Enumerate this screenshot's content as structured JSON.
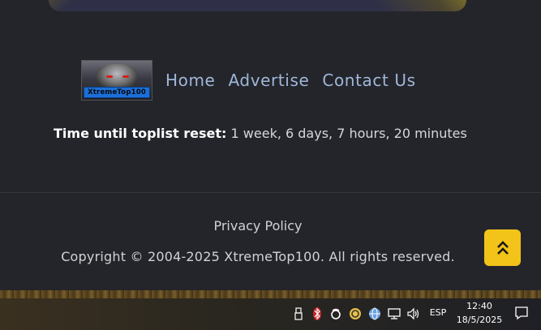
{
  "nav": {
    "logo_text": "XtremeTop100",
    "links": [
      "Home",
      "Advertise",
      "Contact Us"
    ]
  },
  "reset": {
    "label": "Time until toplist reset:",
    "value": "1 week, 6 days, 7 hours, 20 minutes"
  },
  "footer": {
    "privacy_label": "Privacy Policy",
    "copyright": "Copyright © 2004-2025 XtremeTop100. All rights reserved."
  },
  "scroll_top": {
    "icon": "double-chevron-up-icon",
    "color": "#f2c318"
  },
  "colors": {
    "background": "#24252b",
    "nav_link": "#9fb7d8",
    "accent": "#f2c318"
  },
  "taskbar": {
    "language": "ESP",
    "time": "12:40",
    "date": "18/5/2025",
    "tray_icons": [
      "usb-icon",
      "bluetooth-icon",
      "steam-icon",
      "app-icon",
      "browser-icon",
      "network-icon",
      "volume-icon",
      "notification-icon"
    ]
  }
}
